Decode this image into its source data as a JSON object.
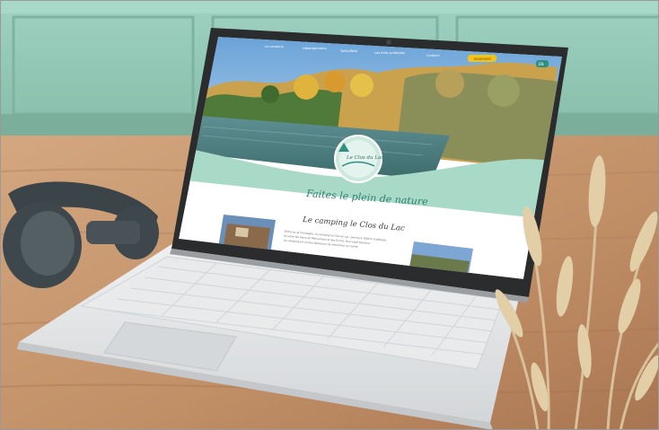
{
  "website": {
    "nav_items": [
      "Le camping",
      "Hébergements",
      "Tarifs/Résa",
      "Les infos pratiques",
      "Contact"
    ],
    "cta_label": "RESERVER",
    "lang_label": "EN",
    "logo_text": "Le Clos du Lac",
    "tagline": "Faites le plein de nature",
    "section_title": "Le camping le Clos du Lac",
    "intro_lines": [
      "Entre lac et montagne, le Camping Le Clos du Lac, perché à 1000 m d'altitude",
      "et entre les parcs du Mercantour et des Ecrins, fera votre bonheur...",
      "Le camping est un lieu idéal pour se ressourcer au calme"
    ]
  },
  "colors": {
    "wall": "#8fc6b5",
    "table": "#c79a72",
    "laptop_body": "#e4e6e8",
    "website_mint": "#a9dac8",
    "cta": "#f3c316"
  }
}
